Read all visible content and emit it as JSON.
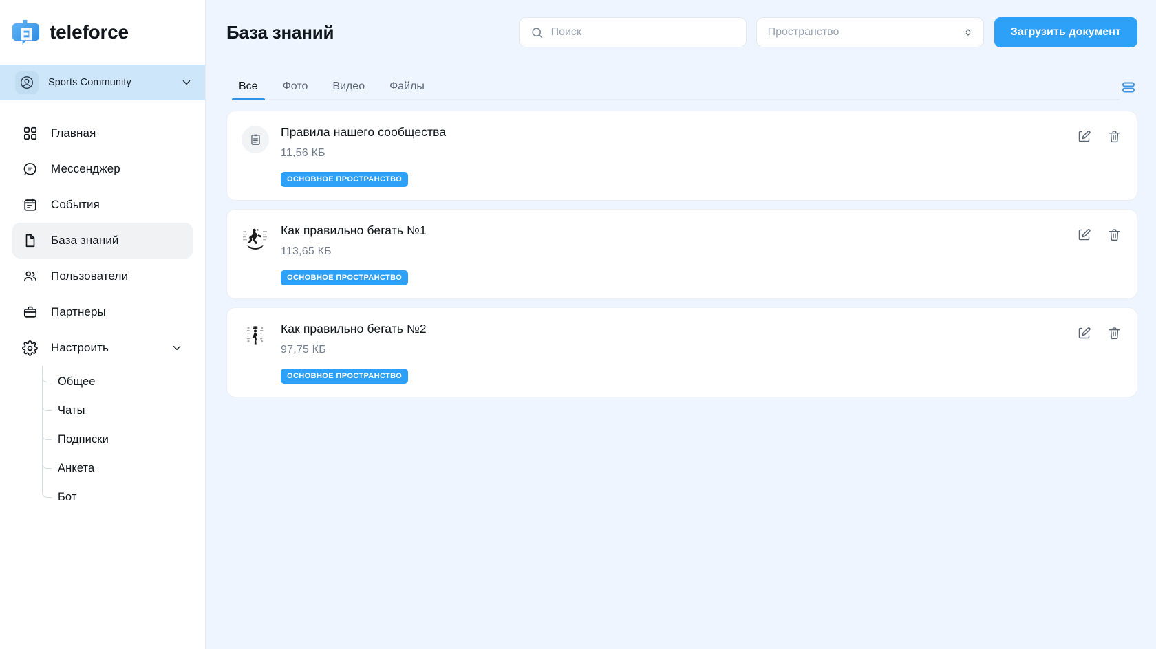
{
  "brand": {
    "name": "teleforce",
    "logo_icon": "teleforce-logo-icon"
  },
  "workspace": {
    "name": "Sports Community",
    "avatar_icon": "user-circle-icon",
    "chevron_icon": "chevron-down-icon"
  },
  "sidebar": {
    "items": [
      {
        "label": "Главная",
        "icon": "grid-icon",
        "active": false
      },
      {
        "label": "Мессенджер",
        "icon": "chat-bubble-icon",
        "active": false
      },
      {
        "label": "События",
        "icon": "calendar-icon",
        "active": false
      },
      {
        "label": "База знаний",
        "icon": "document-icon",
        "active": true
      },
      {
        "label": "Пользователи",
        "icon": "users-icon",
        "active": false
      },
      {
        "label": "Партнеры",
        "icon": "briefcase-icon",
        "active": false
      },
      {
        "label": "Настроить",
        "icon": "gear-icon",
        "active": false,
        "expandable": true,
        "chevron_icon": "chevron-down-icon"
      }
    ],
    "settings_children": [
      {
        "label": "Общее"
      },
      {
        "label": "Чаты"
      },
      {
        "label": "Подписки"
      },
      {
        "label": "Анкета"
      },
      {
        "label": "Бот"
      }
    ]
  },
  "header": {
    "title": "База знаний",
    "search": {
      "placeholder": "Поиск",
      "value": "",
      "icon": "search-icon"
    },
    "space_select": {
      "placeholder": "Пространство",
      "value": "",
      "icon": "chevron-updown-icon"
    },
    "upload_button": {
      "label": "Загрузить документ"
    }
  },
  "tabs": {
    "items": [
      {
        "label": "Все",
        "active": true
      },
      {
        "label": "Фото",
        "active": false
      },
      {
        "label": "Видео",
        "active": false
      },
      {
        "label": "Файлы",
        "active": false
      }
    ],
    "view_toggle_icon": "list-view-icon"
  },
  "documents": [
    {
      "title": "Правила нашего сообщества",
      "size": "11,56 КБ",
      "badge": "ОСНОВНОЕ ПРОСТРАНСТВО",
      "thumb_icon": "clipboard-document-icon",
      "thumb_type": "icon",
      "edit_icon": "edit-pencil-icon",
      "delete_icon": "trash-icon"
    },
    {
      "title": "Как правильно бегать №1",
      "size": "113,65 КБ",
      "badge": "ОСНОВНОЕ ПРОСТРАНСТВО",
      "thumb_icon": "runner-photo-thumbnail",
      "thumb_type": "photo",
      "edit_icon": "edit-pencil-icon",
      "delete_icon": "trash-icon"
    },
    {
      "title": "Как правильно бегать №2",
      "size": "97,75 КБ",
      "badge": "ОСНОВНОЕ ПРОСТРАНСТВО",
      "thumb_icon": "runner-photo-thumbnail",
      "thumb_type": "photo",
      "edit_icon": "edit-pencil-icon",
      "delete_icon": "trash-icon"
    }
  ],
  "colors": {
    "accent": "#2da1f8",
    "tab_underline": "#2f94e8",
    "main_bg": "#eff5fe",
    "workspace_bg": "#cee6f9",
    "sidebar_active": "#f1f2f4"
  }
}
